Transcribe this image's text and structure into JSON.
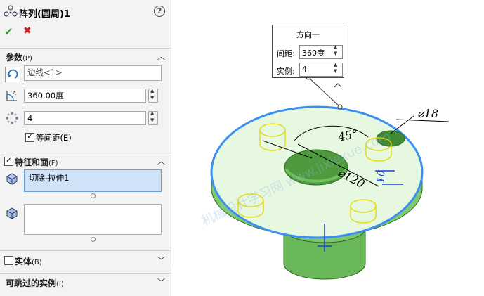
{
  "feature": {
    "title": "阵列(圆周)1",
    "help_label": "?"
  },
  "actions": {
    "ok_icon": "checkmark-icon",
    "cancel_icon": "x-icon"
  },
  "parameters": {
    "label": "参数",
    "key": "(P)",
    "direction_value": "边线<1>",
    "angle_value": "360.00度",
    "count_value": "4",
    "equal_spacing_label": "等间距(E)",
    "equal_spacing_checked": true
  },
  "features_faces": {
    "label": "特征和面",
    "key": "(F)",
    "features": [
      "切除-拉伸1"
    ],
    "faces": []
  },
  "bodies": {
    "label": "实体",
    "key": "(B)"
  },
  "skip": {
    "label": "可跳过的实例",
    "key": "(I)"
  },
  "callout": {
    "title": "方向一",
    "spacing_label": "间距:",
    "spacing_value": "360度",
    "instances_label": "实例:",
    "instances_value": "4"
  },
  "dimensions": {
    "hole_dia": "⌀18",
    "pcd": "⌀120",
    "angle": "45°",
    "small": "10"
  },
  "watermark": "机械设计学习网 www.jixiexue.com",
  "colors": {
    "body": "#8fd17a",
    "top_face": "#e6f8df",
    "selection": "#3b8ff0",
    "preview": "#f3e600"
  }
}
